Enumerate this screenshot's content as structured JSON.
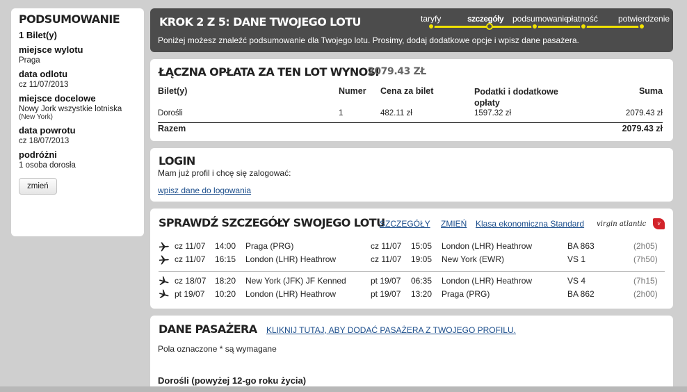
{
  "sidebar": {
    "title": "PODSUMOWANIE",
    "tickets": "1 Bilet(y)",
    "items": [
      {
        "label": "miejsce wylotu",
        "value": "Praga",
        "sub": ""
      },
      {
        "label": "data odlotu",
        "value": "cz 11/07/2013",
        "sub": ""
      },
      {
        "label": "miejsce docelowe",
        "value": "Nowy Jork wszystkie lotniska",
        "sub": "(New York)"
      },
      {
        "label": "data powrotu",
        "value": "cz 18/07/2013",
        "sub": ""
      },
      {
        "label": "podróżni",
        "value": "1 osoba dorosła",
        "sub": ""
      }
    ],
    "change_button": "zmień"
  },
  "step": {
    "title": "KROK 2 Z 5: DANE TWOJEGO LOTU",
    "description": "Poniżej możesz znaleźć podsumowanie dla Twojego lotu. Prosimy, dodaj dodatkowe opcje i wpisz dane pasażera.",
    "progress": [
      "taryfy",
      "szczegóły",
      "podsumowanie",
      "płatność",
      "potwierdzenie"
    ],
    "active_step": "szczegóły",
    "accent_color": "#f1e200"
  },
  "fare": {
    "title": "ŁĄCZNA OPŁATA ZA TEN LOT WYNOSI",
    "amount": "2079.43 ZŁ",
    "headers": {
      "ticket": "Bilet(y)",
      "number": "Numer",
      "price": "Cena za bilet",
      "taxes": "Podatki i dodatkowe opłaty",
      "sum": "Suma"
    },
    "row": {
      "ticket": "Dorośli",
      "number": "1",
      "price": "482.11 zł",
      "taxes": "1597.32 zł",
      "sum": "2079.43 zł"
    },
    "total": {
      "label": "Razem",
      "sum": "2079.43 zł"
    }
  },
  "login": {
    "title": "LOGIN",
    "text": "Mam już profil i chcę się zalogować:",
    "link": "wpisz dane do logowania"
  },
  "flight": {
    "title": "SPRAWDŹ SZCZEGÓŁY SWOJEGO LOTU",
    "details_link": "SZCZEGÓŁY",
    "change_link": "ZMIEŃ",
    "class_link": "Klasa ekonomiczna Standard",
    "airline_logo_text": "virgin atlantic",
    "segments": [
      {
        "dep_date": "cz 11/07",
        "dep_time": "14:00",
        "from": "Praga (PRG)",
        "arr_date": "cz 11/07",
        "arr_time": "15:05",
        "to": "London (LHR) Heathrow",
        "flight": "BA 863",
        "duration": "(2h05)",
        "direction": "out"
      },
      {
        "dep_date": "cz 11/07",
        "dep_time": "16:15",
        "from": "London (LHR) Heathrow",
        "arr_date": "cz 11/07",
        "arr_time": "19:05",
        "to": "New York (EWR)",
        "flight": "VS 1",
        "duration": "(7h50)",
        "direction": "out"
      },
      {
        "dep_date": "cz 18/07",
        "dep_time": "18:20",
        "from": "New York (JFK) JF Kenned",
        "arr_date": "pt 19/07",
        "arr_time": "06:35",
        "to": "London (LHR) Heathrow",
        "flight": "VS 4",
        "duration": "(7h15)",
        "direction": "back"
      },
      {
        "dep_date": "pt 19/07",
        "dep_time": "10:20",
        "from": "London (LHR) Heathrow",
        "arr_date": "pt 19/07",
        "arr_time": "13:20",
        "to": "Praga (PRG)",
        "flight": "BA 862",
        "duration": "(2h00)",
        "direction": "back"
      }
    ]
  },
  "passenger": {
    "title": "DANE PASAŻERA",
    "profile_link": "KLIKNIJ TUTAJ, ABY DODAĆ PASAŻERA Z TWOJEGO PROFILU.",
    "required_note": "Pola oznaczone * są wymagane",
    "group": "Dorośli (powyżej 12-go roku życia)"
  }
}
